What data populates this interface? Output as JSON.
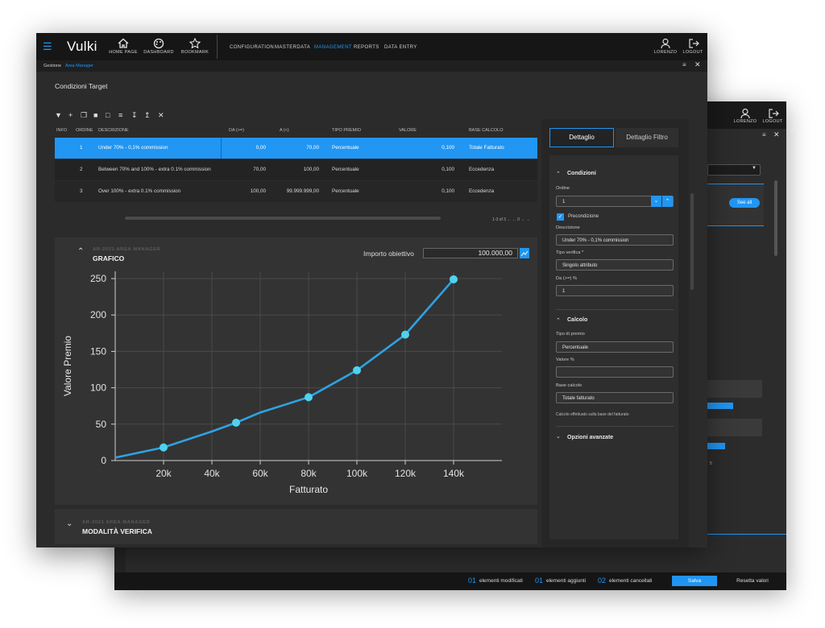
{
  "app": {
    "title": "Vulki"
  },
  "nav": {
    "home": "HOME PAGE",
    "dashboard": "DASHBOARD",
    "bookmark": "BOOKMARK",
    "menu": [
      "CONFIGURATION",
      "MASTERDATA",
      "MANAGEMENT",
      "REPORTS",
      "DATA ENTRY"
    ],
    "user": "LORENZO",
    "logout": "LOGOUT"
  },
  "breadcrumb": {
    "root": "Gestione",
    "current": "Area Manager"
  },
  "page": {
    "title": "Condizioni Target"
  },
  "table": {
    "headers": [
      "INFO",
      "ORDINE",
      "DESCRIZIONE",
      "DA (>=)",
      "A (<)",
      "TIPO PREMIO",
      "VALORE",
      "BASE CALCOLO"
    ],
    "rows": [
      {
        "ordine": "1",
        "descrizione": "Under 70% - 0,1% commission",
        "da": "0,00",
        "a": "70,00",
        "tipo": "Percentuale",
        "valore": "0,100",
        "base": "Totale Fatturato"
      },
      {
        "ordine": "2",
        "descrizione": "Between 70% and 100% - extra 0.1% commission",
        "da": "70,00",
        "a": "100,00",
        "tipo": "Percentuale",
        "valore": "0,100",
        "base": "Eccedenza"
      },
      {
        "ordine": "3",
        "descrizione": "Over 100% - extra 0.1% commission",
        "da": "100,00",
        "a": "99.999.999,00",
        "tipo": "Percentuale",
        "valore": "0,100",
        "base": "Eccedenza"
      }
    ],
    "pagination": "1-3 of 3   ← ←  0  → →"
  },
  "grafico": {
    "subtitle": "AR-2021 AREA MANAGER",
    "title": "GRAFICO",
    "importo_label": "Importo obiettivo",
    "importo_value": "100.000,00"
  },
  "modalita": {
    "subtitle": "AR-2021 AREA MANAGER",
    "title": "MODALITÀ VERIFICA"
  },
  "chart_data": {
    "type": "line",
    "x": [
      0,
      20000,
      40000,
      50000,
      60000,
      80000,
      100000,
      120000,
      140000
    ],
    "y": [
      4,
      18,
      40,
      52,
      66,
      87,
      124,
      173,
      249
    ],
    "markers": [
      20000,
      50000,
      80000,
      100000,
      120000,
      140000
    ],
    "xticks": [
      "20k",
      "40k",
      "60k",
      "80k",
      "100k",
      "120k",
      "140k"
    ],
    "yticks": [
      "0",
      "50",
      "100",
      "150",
      "200",
      "250"
    ],
    "xlabel": "Fatturato",
    "ylabel": "Valore Premio",
    "xlim": [
      0,
      160000
    ],
    "ylim": [
      0,
      260
    ],
    "color": "#2ea3e3",
    "marker_color": "#4fd2ef",
    "grid": true
  },
  "detail": {
    "tabs": [
      "Dettaglio",
      "Dettaglio Filtro"
    ],
    "condizioni": {
      "title": "Condizioni",
      "ordine_label": "Ordine",
      "ordine_value": "1",
      "precondizione": "Precondizione",
      "descrizione_label": "Descrizione",
      "descrizione_value": "Under 70% - 0,1% commission",
      "tipo_verifica_label": "Tipo verifica *",
      "tipo_verifica_value": "Singolo attributo",
      "da_label": "Da (>=) %",
      "da_value": "1"
    },
    "calcolo": {
      "title": "Calcolo",
      "tipo_premio_label": "Tipo di premio",
      "tipo_premio_value": "Percentuale",
      "valore_label": "Valore %",
      "valore_value": "",
      "base_label": "Base calcolo",
      "base_value": "Totale fatturato",
      "note": "Calcolo effettuato sulla base del fatturato"
    },
    "opzioni": {
      "title": "Opzioni avanzate"
    }
  },
  "back": {
    "user": "LORENZO",
    "logout": "LOGOUT",
    "see_all": "See all",
    "bar_tick": "5",
    "footer": {
      "modificati_count": "01",
      "modificati_label": "elementi modificati",
      "aggiunti_count": "01",
      "aggiunti_label": "elementi aggiunti",
      "cancellati_count": "02",
      "cancellati_label": "elementi cancellati",
      "save": "Salva",
      "reset": "Resetta valori"
    }
  },
  "colors": {
    "accent": "#2196f3",
    "selected_row": "#2196f3",
    "background": "#2b2b2b"
  }
}
